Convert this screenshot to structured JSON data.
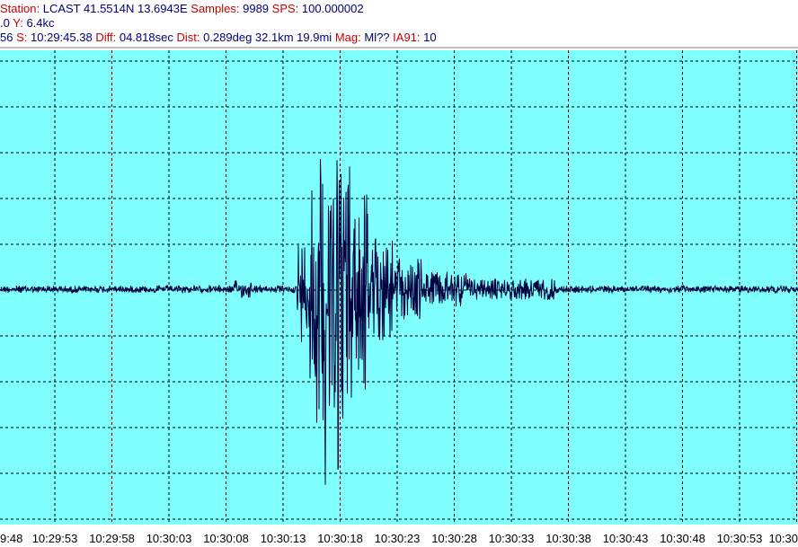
{
  "header": {
    "line1": {
      "station_label": "Station:",
      "station_value": "LCAST 41.5514N 13.6943E",
      "samples_label": "Samples:",
      "samples_value": "9989",
      "sps_label": "SPS:",
      "sps_value": "100.000002"
    },
    "line2": {
      "x_value": ".0",
      "y_label": "Y:",
      "y_value": "6.4kc"
    },
    "line3": {
      "p_partial": "56",
      "s_label": "S:",
      "s_value": "10:29:45.38",
      "diff_label": "Diff:",
      "diff_value": "04.818sec",
      "dist_label": "Dist:",
      "dist_value": "0.289deg 32.1km 19.9mi",
      "mag_label": "Mag:",
      "mag_value": "Ml??",
      "ia_label": "IA91:",
      "ia_value": "10"
    }
  },
  "time_axis": {
    "labels": [
      "9:48",
      "10:29:53",
      "10:29:58",
      "10:30:03",
      "10:30:08",
      "10:30:13",
      "10:30:18",
      "10:30:23",
      "10:30:28",
      "10:30:33",
      "10:30:38",
      "10:30:43",
      "10:30:48",
      "10:30:53",
      "10:30"
    ]
  },
  "colors": {
    "plot_background": "#80ffff",
    "trace": "#000040",
    "grid": "#000000",
    "label_red": "#c80000",
    "value_navy": "#000080"
  }
}
